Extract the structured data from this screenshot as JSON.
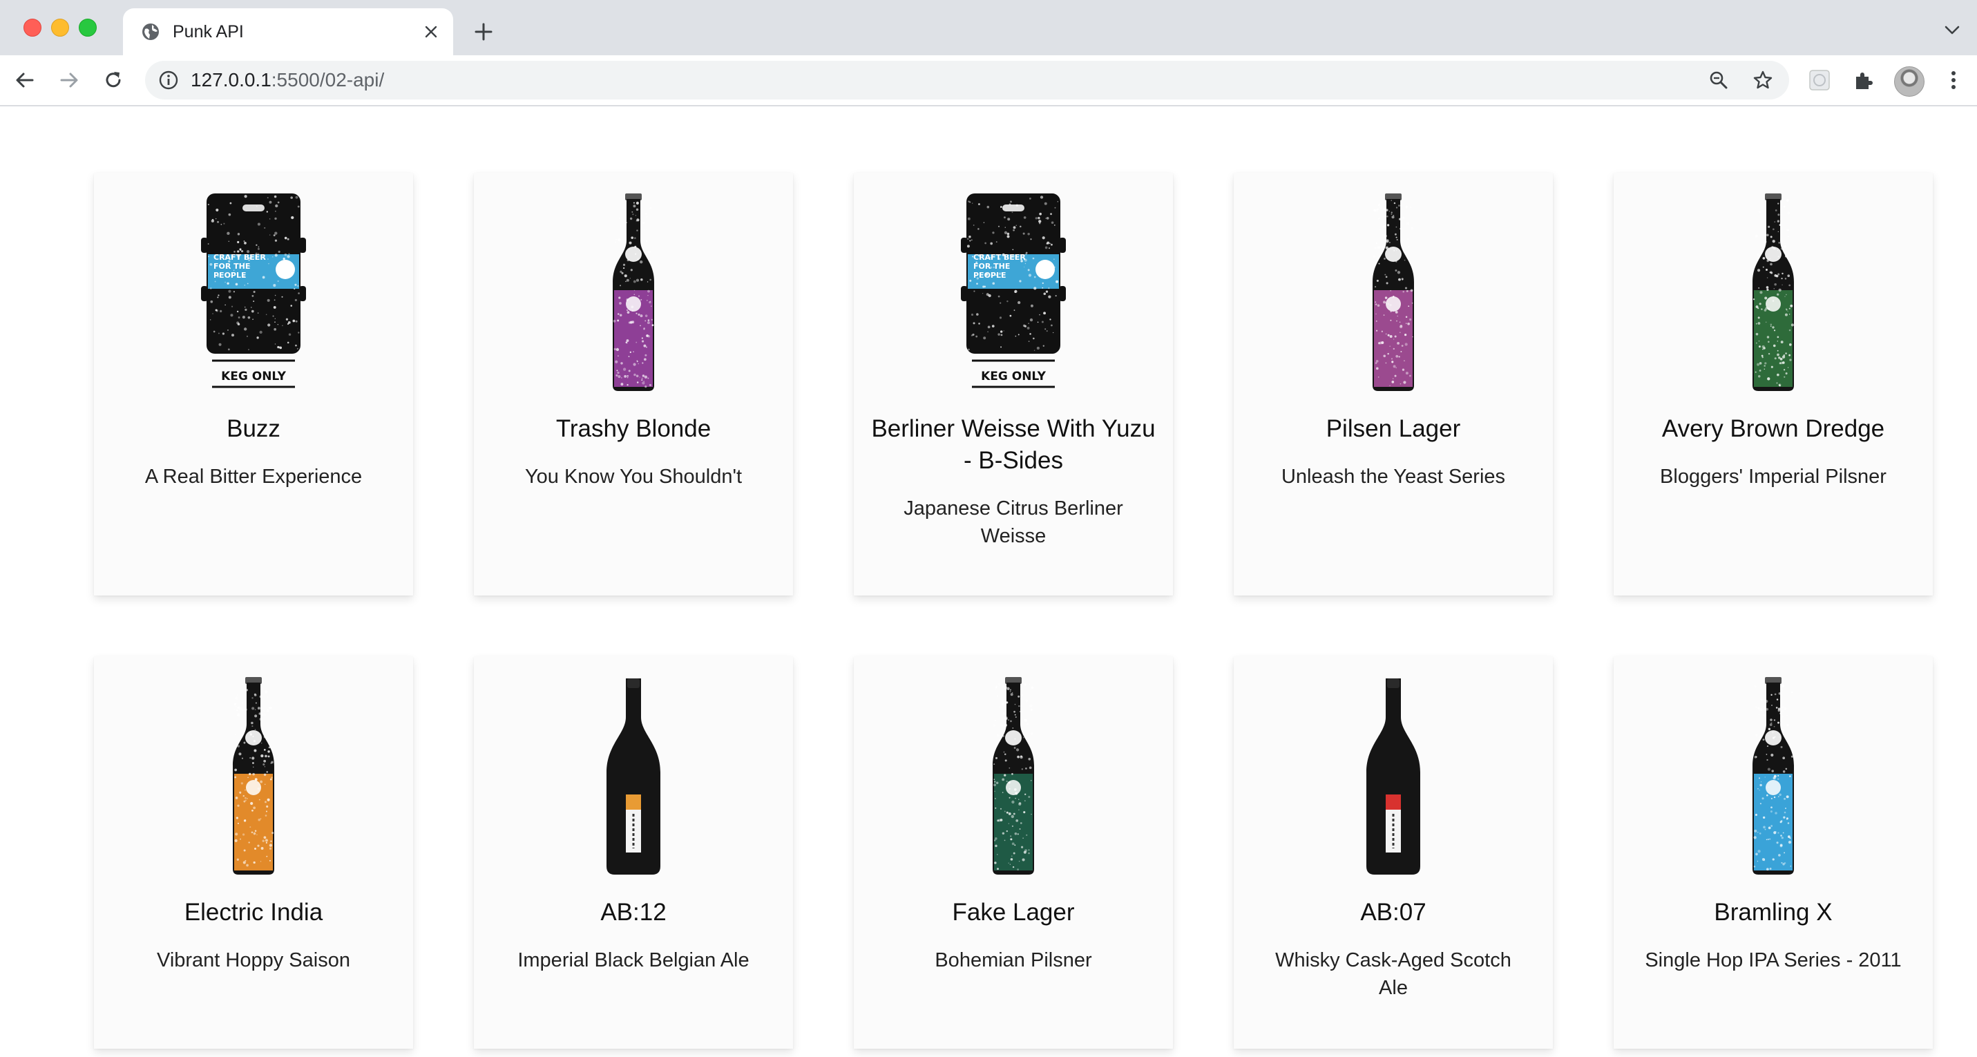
{
  "browser": {
    "tab_title": "Punk API",
    "url_host": "127.0.0.1",
    "url_path": ":5500/02-api/"
  },
  "beers": [
    {
      "name": "Buzz",
      "tagline": "A Real Bitter Experience",
      "image": "keg",
      "label_color": "#3ea6d6"
    },
    {
      "name": "Trashy Blonde",
      "tagline": "You Know You Shouldn't",
      "image": "bottle",
      "label_color": "#8e3f96"
    },
    {
      "name": "Berliner Weisse With Yuzu - B-Sides",
      "tagline": "Japanese Citrus Berliner Weisse",
      "image": "keg",
      "label_color": "#3ea6d6"
    },
    {
      "name": "Pilsen Lager",
      "tagline": "Unleash the Yeast Series",
      "image": "bottle",
      "label_color": "#9b4a8f"
    },
    {
      "name": "Avery Brown Dredge",
      "tagline": "Bloggers' Imperial Pilsner",
      "image": "bottle",
      "label_color": "#2e6b3a"
    },
    {
      "name": "Electric India",
      "tagline": "Vibrant Hoppy Saison",
      "image": "bottle",
      "label_color": "#e28a2a"
    },
    {
      "name": "AB:12",
      "tagline": "Imperial Black Belgian Ale",
      "image": "tall-bottle",
      "label_color": "#e89b34"
    },
    {
      "name": "Fake Lager",
      "tagline": "Bohemian Pilsner",
      "image": "bottle",
      "label_color": "#1f5a45"
    },
    {
      "name": "AB:07",
      "tagline": "Whisky Cask-Aged Scotch Ale",
      "image": "tall-bottle",
      "label_color": "#d8322f"
    },
    {
      "name": "Bramling X",
      "tagline": "Single Hop IPA Series - 2011",
      "image": "bottle",
      "label_color": "#3aa3d8"
    }
  ],
  "keg_label": {
    "line1": "CRAFT BEER",
    "line2": "FOR THE",
    "line3": "PEOPLE",
    "footer": "KEG ONLY"
  }
}
